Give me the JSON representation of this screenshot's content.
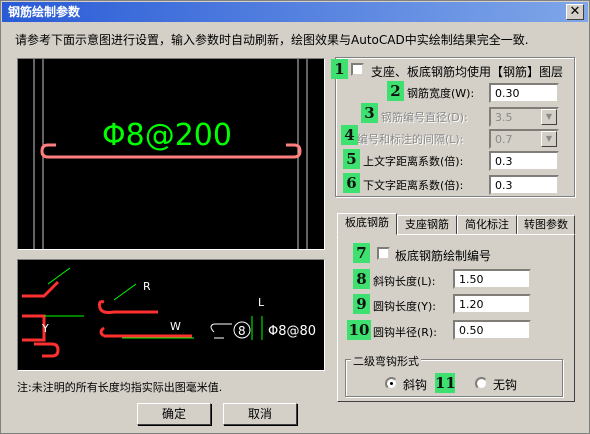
{
  "window": {
    "title": "钢筋绘制参数",
    "close_glyph": "✕",
    "intro": "请参考下面示意图进行设置，输入参数时自动刷新，绘图效果与AutoCAD中实绘制结果完全一致."
  },
  "preview_top": {
    "text": "Φ8@200"
  },
  "preview_bottom": {
    "label_R": "R",
    "label_W": "W",
    "label_L": "L",
    "label_Y": "Y",
    "circle_num": "8",
    "spacing_text": "Φ8@80"
  },
  "badges": [
    "1",
    "2",
    "3",
    "4",
    "5",
    "6",
    "7",
    "8",
    "9",
    "10",
    "11"
  ],
  "settings": {
    "use_layer_label": "支座、板底钢筋均使用【钢筋】图层",
    "bar_width_label": "钢筋宽度(W):",
    "bar_width_value": "0.30",
    "number_diameter_label": "钢筋编号直径(D):",
    "number_diameter_value": "3.5",
    "number_gap_label": "编号和标注的间隔(L):",
    "number_gap_value": "0.7",
    "upper_text_label": "上文字距离系数(倍):",
    "upper_text_value": "0.3",
    "lower_text_label": "下文字距离系数(倍):",
    "lower_text_value": "0.3"
  },
  "tabs": [
    "板底钢筋",
    "支座钢筋",
    "简化标注",
    "转图参数"
  ],
  "bottom_bar": {
    "draw_number_label": "板底钢筋绘制编号",
    "hook_length_label": "斜钩长度(L):",
    "hook_length_value": "1.50",
    "round_hook_length_label": "圆钩长度(Y):",
    "round_hook_length_value": "1.20",
    "round_hook_radius_label": "圆钩半径(R):",
    "round_hook_radius_value": "0.50",
    "second_hook_group": "二级弯钩形式",
    "hook_option_slant": "斜钩",
    "hook_option_none": "无钩"
  },
  "footnote": "注:未注明的所有长度均指实际出图毫米值.",
  "buttons": {
    "ok": "确定",
    "cancel": "取消"
  },
  "colors": {
    "bar": "#ff7f7f",
    "text_green": "#00ff00",
    "dim_green": "#00ff00",
    "badge": "#3ee070"
  }
}
